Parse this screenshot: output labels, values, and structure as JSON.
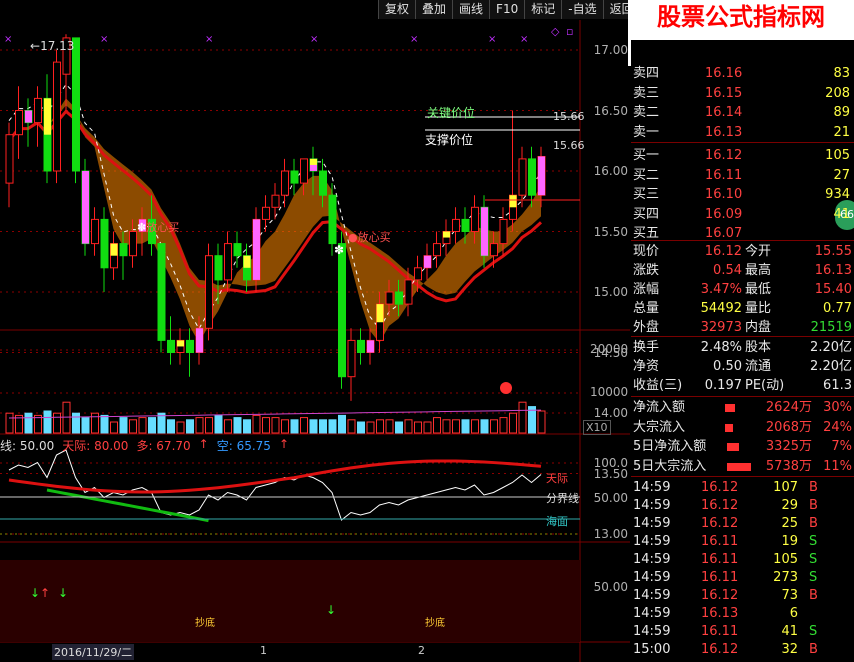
{
  "toolbar": {
    "items": [
      "复权",
      "叠加",
      "画线",
      "F10",
      "标记",
      "-自选",
      "返回"
    ]
  },
  "watermark": {
    "title": "股票公式指标网",
    "url": "www.gsxx.com.cn"
  },
  "main_chart": {
    "high_label": "17.13",
    "price_axis": [
      "17.00",
      "16.50",
      "16.00",
      "15.50",
      "15.00",
      "14.50",
      "14.00",
      "13.50",
      "13.00"
    ],
    "key_price_label": "关键价位",
    "key_price_value": "15.66",
    "support_label": "支撑价位",
    "support_value": "15.66",
    "signal1": "放心买",
    "signal2": "放心买",
    "candles": [
      [
        15.9,
        16.3,
        15.7,
        16.4
      ],
      [
        16.3,
        16.5,
        16.1,
        16.7
      ],
      [
        16.5,
        16.4,
        16.2,
        16.6
      ],
      [
        16.4,
        16.6,
        16.2,
        16.7
      ],
      [
        16.6,
        16.0,
        15.9,
        16.8
      ],
      [
        16.0,
        16.9,
        15.9,
        17.0
      ],
      [
        16.8,
        17.1,
        16.5,
        17.13
      ],
      [
        17.1,
        16.0,
        15.9,
        17.1
      ],
      [
        16.0,
        15.4,
        15.3,
        16.1
      ],
      [
        15.4,
        15.6,
        15.3,
        15.7
      ],
      [
        15.6,
        15.2,
        15.0,
        15.7
      ],
      [
        15.2,
        15.4,
        15.1,
        15.5
      ],
      [
        15.4,
        15.3,
        15.1,
        15.5
      ],
      [
        15.3,
        15.5,
        15.2,
        15.6
      ],
      [
        15.5,
        15.6,
        15.3,
        15.7
      ],
      [
        15.6,
        15.4,
        15.3,
        15.8
      ],
      [
        15.4,
        14.6,
        14.5,
        15.4
      ],
      [
        14.6,
        14.5,
        14.4,
        14.8
      ],
      [
        14.5,
        14.6,
        14.4,
        14.7
      ],
      [
        14.6,
        14.5,
        14.3,
        14.7
      ],
      [
        14.5,
        14.7,
        14.4,
        14.8
      ],
      [
        14.7,
        15.3,
        14.6,
        15.4
      ],
      [
        15.3,
        15.1,
        14.9,
        15.4
      ],
      [
        15.1,
        15.4,
        15.0,
        15.5
      ],
      [
        15.4,
        15.3,
        15.2,
        15.5
      ],
      [
        15.3,
        15.1,
        15.0,
        15.4
      ],
      [
        15.1,
        15.6,
        15.0,
        15.7
      ],
      [
        15.6,
        15.7,
        15.5,
        15.8
      ],
      [
        15.7,
        15.8,
        15.6,
        15.9
      ],
      [
        15.8,
        16.0,
        15.7,
        16.1
      ],
      [
        16.0,
        15.9,
        15.8,
        16.1
      ],
      [
        15.9,
        16.1,
        15.8,
        16.1
      ],
      [
        16.1,
        16.0,
        15.8,
        16.2
      ],
      [
        16.0,
        15.8,
        15.7,
        16.1
      ],
      [
        15.8,
        15.4,
        15.3,
        15.9
      ],
      [
        15.4,
        14.3,
        14.2,
        15.5
      ],
      [
        14.3,
        14.6,
        14.1,
        14.7
      ],
      [
        14.6,
        14.5,
        14.4,
        14.7
      ],
      [
        14.5,
        14.6,
        14.4,
        14.7
      ],
      [
        14.6,
        14.9,
        14.5,
        15.0
      ],
      [
        14.9,
        15.0,
        14.8,
        15.1
      ],
      [
        15.0,
        14.9,
        14.8,
        15.1
      ],
      [
        14.9,
        15.1,
        14.8,
        15.2
      ],
      [
        15.1,
        15.2,
        15.0,
        15.3
      ],
      [
        15.2,
        15.3,
        15.1,
        15.4
      ],
      [
        15.3,
        15.4,
        15.2,
        15.5
      ],
      [
        15.4,
        15.5,
        15.3,
        15.6
      ],
      [
        15.5,
        15.6,
        15.4,
        15.7
      ],
      [
        15.6,
        15.5,
        15.4,
        15.7
      ],
      [
        15.5,
        15.7,
        15.4,
        15.8
      ],
      [
        15.7,
        15.3,
        15.2,
        15.8
      ],
      [
        15.3,
        15.4,
        15.2,
        15.5
      ],
      [
        15.4,
        15.6,
        15.3,
        15.7
      ],
      [
        15.6,
        15.8,
        15.5,
        16.5
      ],
      [
        15.8,
        16.1,
        15.7,
        16.2
      ],
      [
        16.1,
        15.8,
        15.7,
        16.2
      ],
      [
        15.8,
        16.12,
        15.7,
        16.2
      ]
    ]
  },
  "volume": {
    "axis": [
      "20000",
      "10000"
    ],
    "ratio_label": "X10",
    "values": [
      9,
      8,
      9,
      8,
      10,
      9,
      14,
      9,
      7,
      9,
      8,
      5,
      7,
      6,
      7,
      7,
      9,
      6,
      5,
      6,
      7,
      7,
      8,
      6,
      7,
      6,
      8,
      7,
      7,
      6,
      6,
      7,
      6,
      6,
      6,
      8,
      6,
      5,
      5,
      6,
      6,
      5,
      6,
      5,
      5,
      7,
      6,
      6,
      6,
      6,
      6,
      6,
      7,
      9,
      14,
      12,
      10
    ]
  },
  "indicator": {
    "header": "线: 50.00",
    "tianji_label": "天际: 80.00",
    "duo_label": "多: 67.70",
    "kong_label": "空: 65.75",
    "axis": [
      "100.0",
      "50.00"
    ],
    "right_labels": {
      "tianji": "天际",
      "fenjie": "分界线",
      "haimian": "海面"
    }
  },
  "lower": {
    "axis": "50.00",
    "date_label": "2016/11/29/二",
    "marker1": "1",
    "marker2": "2",
    "badge1": "抄底",
    "badge2": "抄底"
  },
  "orderbook": {
    "sell": [
      {
        "label": "卖四",
        "price": "16.16",
        "vol": "83"
      },
      {
        "label": "卖三",
        "price": "16.15",
        "vol": "208"
      },
      {
        "label": "卖二",
        "price": "16.14",
        "vol": "89"
      },
      {
        "label": "卖一",
        "price": "16.13",
        "vol": "21"
      }
    ],
    "buy": [
      {
        "label": "买一",
        "price": "16.12",
        "vol": "105"
      },
      {
        "label": "买二",
        "price": "16.11",
        "vol": "27"
      },
      {
        "label": "买三",
        "price": "16.10",
        "vol": "934"
      },
      {
        "label": "买四",
        "price": "16.09",
        "vol": "41"
      },
      {
        "label": "买五",
        "price": "16.07",
        "vol": ""
      }
    ],
    "badge": "66"
  },
  "quote": [
    {
      "l1": "现价",
      "v1": "16.12",
      "l2": "今开",
      "v2": "15.55"
    },
    {
      "l1": "涨跌",
      "v1": "0.54",
      "l2": "最高",
      "v2": "16.13"
    },
    {
      "l1": "涨幅",
      "v1": "3.47%",
      "l2": "最低",
      "v2": "15.40"
    },
    {
      "l1": "总量",
      "v1": "54492",
      "l2": "量比",
      "v2": "0.77"
    },
    {
      "l1": "外盘",
      "v1": "32973",
      "l2": "内盘",
      "v2": "21519"
    }
  ],
  "fundamentals": [
    {
      "l1": "换手",
      "v1": "2.48%",
      "l2": "股本",
      "v2": "2.20亿"
    },
    {
      "l1": "净资",
      "v1": "0.50",
      "l2": "流通",
      "v2": "2.20亿"
    },
    {
      "l1": "收益(三)",
      "v1": "0.197",
      "l2": "PE(动)",
      "v2": "61.3"
    }
  ],
  "flows": [
    {
      "label": "净流入额",
      "value": "2624万",
      "pct": "30%",
      "bar": 0.12
    },
    {
      "label": "大宗流入",
      "value": "2068万",
      "pct": "24%",
      "bar": 0.1
    },
    {
      "label": "5日净流入额",
      "value": "3325万",
      "pct": "7%",
      "bar": 0.15
    },
    {
      "label": "5日大宗流入",
      "value": "5738万",
      "pct": "11%",
      "bar": 0.3
    }
  ],
  "ticks": [
    {
      "time": "14:59",
      "price": "16.12",
      "vol": "107",
      "side": "B"
    },
    {
      "time": "14:59",
      "price": "16.12",
      "vol": "29",
      "side": "B"
    },
    {
      "time": "14:59",
      "price": "16.12",
      "vol": "25",
      "side": "B"
    },
    {
      "time": "14:59",
      "price": "16.11",
      "vol": "19",
      "side": "S"
    },
    {
      "time": "14:59",
      "price": "16.11",
      "vol": "105",
      "side": "S"
    },
    {
      "time": "14:59",
      "price": "16.11",
      "vol": "273",
      "side": "S"
    },
    {
      "time": "14:59",
      "price": "16.12",
      "vol": "73",
      "side": "B"
    },
    {
      "time": "14:59",
      "price": "16.13",
      "vol": "6",
      "side": ""
    },
    {
      "time": "14:59",
      "price": "16.11",
      "vol": "41",
      "side": "S"
    },
    {
      "time": "15:00",
      "price": "16.12",
      "vol": "32",
      "side": "B"
    }
  ]
}
